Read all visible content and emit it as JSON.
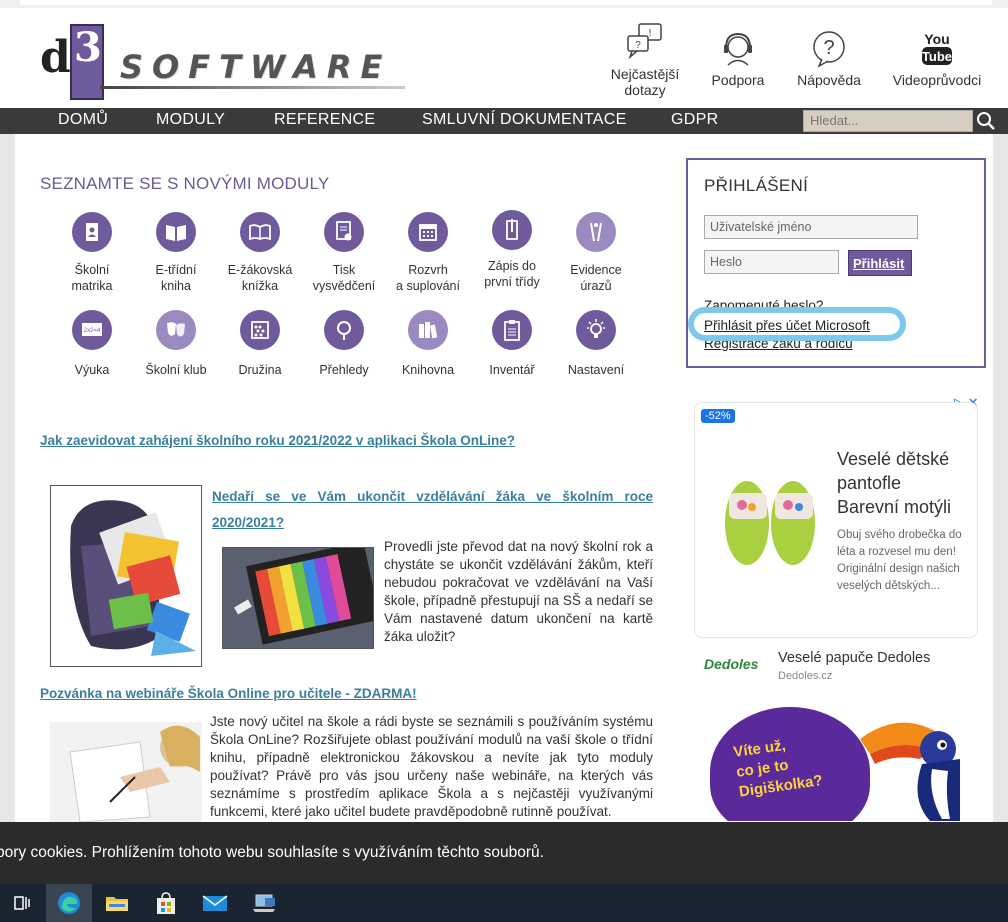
{
  "header": {
    "logo_text": "SOFTWARE",
    "links": [
      {
        "label": "Nejčastější dotazy",
        "line1": "Nejčastější",
        "line2": "dotazy"
      },
      {
        "label": "Podpora"
      },
      {
        "label": "Nápověda"
      },
      {
        "label": "Videoprůvodci"
      }
    ]
  },
  "nav": {
    "items": [
      "DOMŮ",
      "MODULY",
      "REFERENCE",
      "SMLUVNÍ DOKUMENTACE",
      "GDPR"
    ],
    "search_placeholder": "Hledat..."
  },
  "modules": {
    "title": "SEZNAMTE SE S NOVÝMI MODULY",
    "row1": [
      {
        "l1": "Školní",
        "l2": "matrika",
        "icon": "id-card-icon"
      },
      {
        "l1": "E-třídní",
        "l2": "kniha",
        "icon": "book-icon"
      },
      {
        "l1": "E-žákovská",
        "l2": "knížka",
        "icon": "open-book-icon"
      },
      {
        "l1": "Tisk",
        "l2": "vysvědčení",
        "icon": "certificate-icon"
      },
      {
        "l1": "Rozvrh",
        "l2": "a suplování",
        "icon": "calendar-icon"
      },
      {
        "l1": "Zápis do",
        "l2": "první třídy",
        "icon": "pencil-icon"
      },
      {
        "l1": "Evidence",
        "l2": "úrazů",
        "icon": "bandage-icon"
      }
    ],
    "row2": [
      {
        "l1": "Výuka",
        "icon": "blackboard-icon"
      },
      {
        "l1": "Školní klub",
        "icon": "masks-icon"
      },
      {
        "l1": "Družina",
        "icon": "abacus-icon"
      },
      {
        "l1": "Přehledy",
        "icon": "magnifier-icon"
      },
      {
        "l1": "Knihovna",
        "icon": "books-icon"
      },
      {
        "l1": "Inventář",
        "icon": "clipboard-icon"
      },
      {
        "l1": "Nastavení",
        "icon": "bulb-icon"
      }
    ]
  },
  "articles": {
    "a1_title": "Jak zaevidovat zahájení školního roku 2021/2022 v aplikaci Škola OnLine?",
    "a2_title_l1": "Nedaří se ve Vám ukončit vzdělávání žáka ve školním roce",
    "a2_title_l2": "2020/2021?",
    "a2_text": "Provedli jste převod dat na nový školní rok a chystáte se ukončit vzdělávání žákům, kteří nebudou pokračovat ve vzdělávání na Vaší škole, případně přestupují na SŠ a nedaří se Vám nastavené datum ukončení na kartě žáka uložit?",
    "a3_title": "Pozvánka na webináře Škola Online pro učitele - ZDARMA!",
    "a3_text": "Jste nový učitel na škole a rádi byste se seznámili s používáním systému Škola OnLine? Rozšiřujete oblast používání modulů na vaší škole o třídní knihu, případně elektronickou žákovskou a nevíte jak tyto moduly používat? Právě pro vás jsou určeny naše webináře, na kterých vás seznámíme s prostředím aplikace Škola a s nejčastěji využívanými funkcemi, které jako učitel budete pravděpodobně rutinně používat."
  },
  "login": {
    "title": "PŘIHLÁŠENÍ",
    "username_placeholder": "Uživatelské jméno",
    "password_placeholder": "Heslo",
    "submit": "Přihlásit",
    "forgot": "Zapomenuté heslo?",
    "microsoft": "Přihlásit přes účet Microsoft",
    "register": "Registrace žáků a rodičů"
  },
  "ad": {
    "discount": "-52%",
    "headline_l1": "Veselé dětské",
    "headline_l2": "pantofle",
    "headline_l3": "Barevní motýli",
    "description": "Obuj svého drobečka do léta a rozvesel mu den! Originální design našich veselých dětských...",
    "brand": "Dedoles",
    "brand_title": "Veselé papuče Dedoles",
    "brand_domain": "Dedoles.cz",
    "banner_text_l1": "Víte už,",
    "banner_text_l2": "co je to",
    "banner_text_l3": "Digiškolka?"
  },
  "cookie": {
    "text": "bory cookies. Prohlížením tohoto webu souhlasíte s využíváním těchto souborů."
  },
  "colors": {
    "accent": "#6f5b9b",
    "link": "#3a7f9e",
    "nav_bg": "#3a3a3a",
    "highlight": "#7cc9ec"
  }
}
